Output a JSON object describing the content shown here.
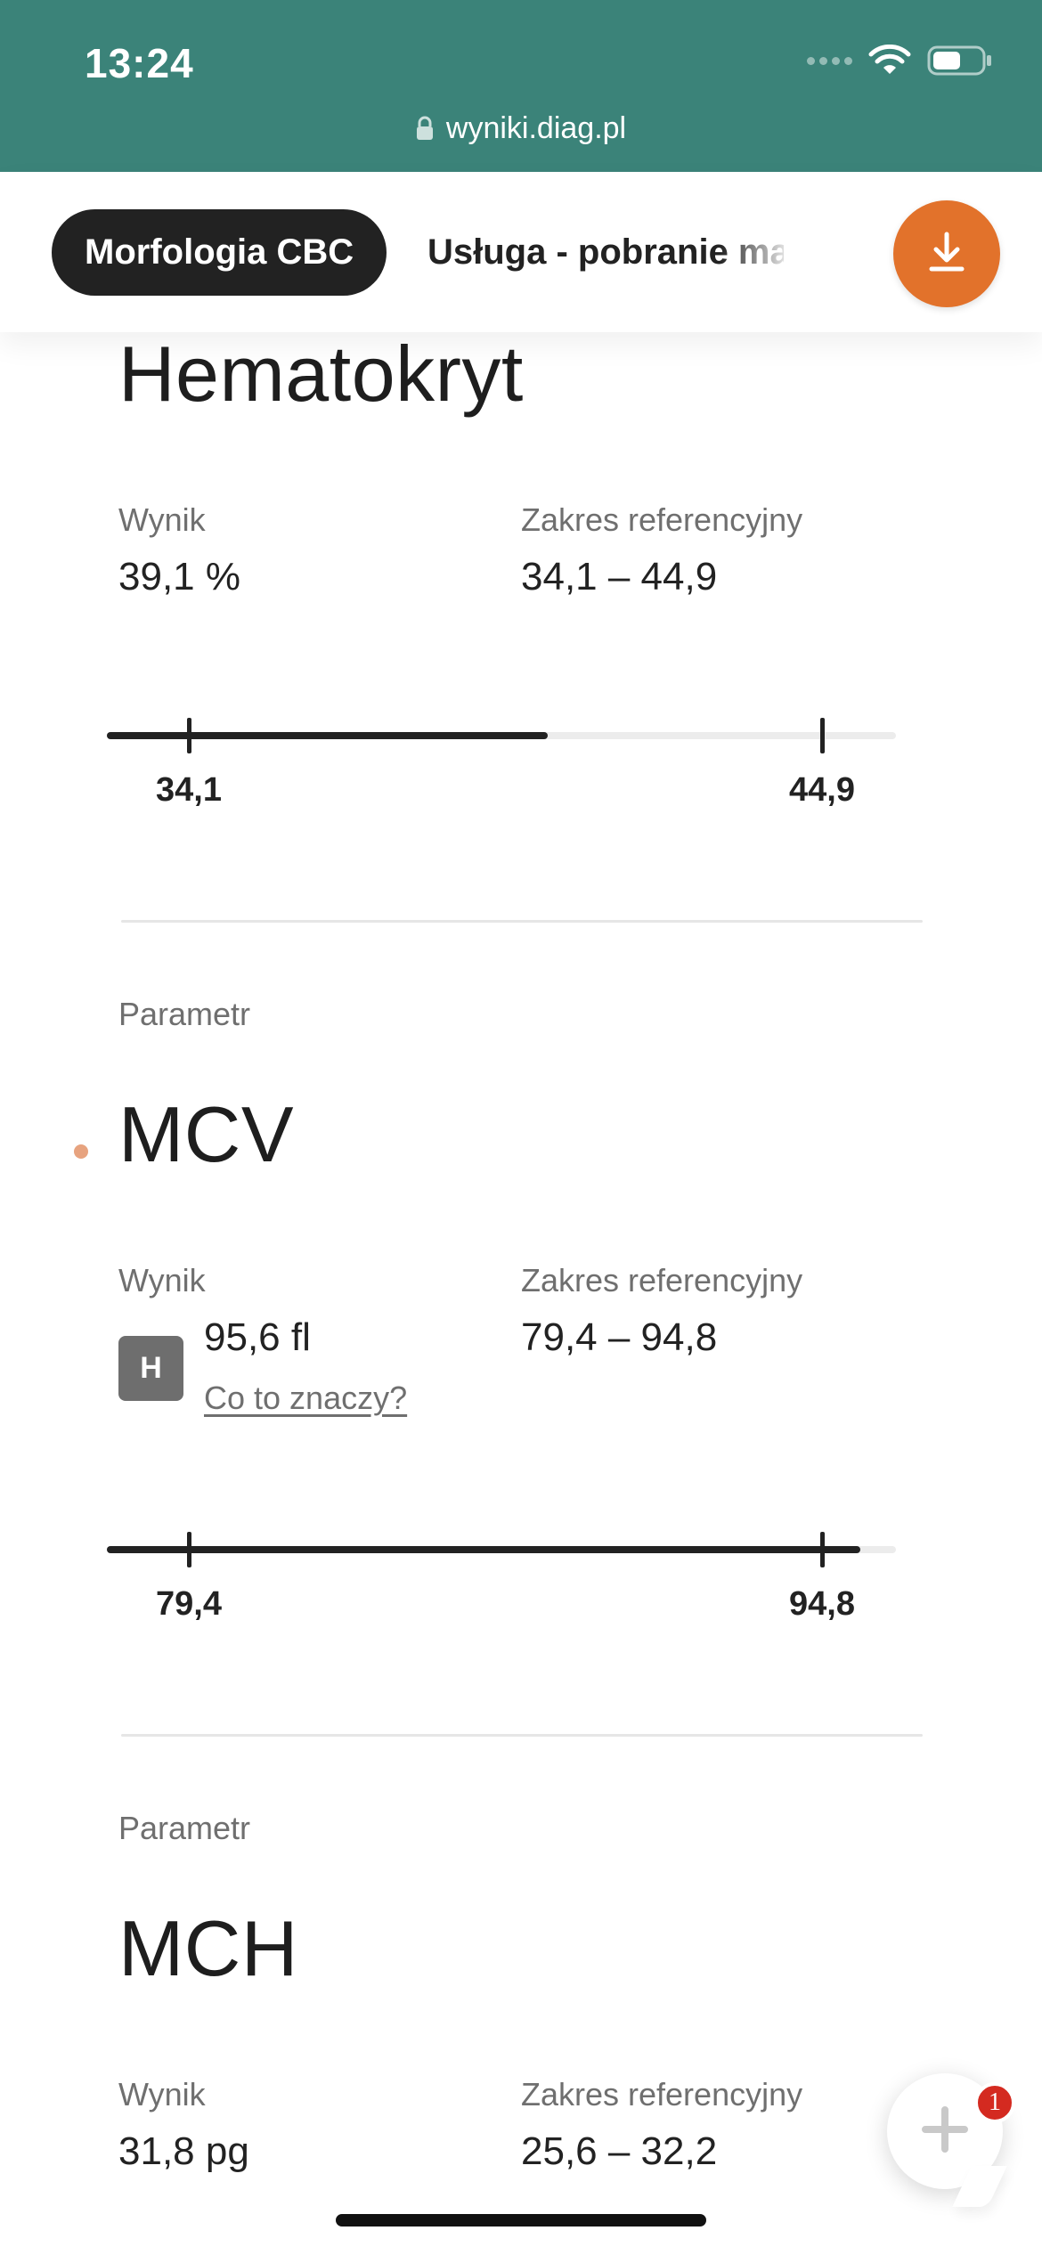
{
  "status_bar": {
    "time": "13:24",
    "url": "wyniki.diag.pl",
    "icons": [
      "signal-icon",
      "wifi-icon",
      "battery-icon",
      "lock-icon"
    ]
  },
  "tabs": [
    {
      "label": "Morfologia CBC",
      "active": true
    },
    {
      "label": "Usługa - pobranie ma",
      "active": false
    }
  ],
  "download_button": {
    "icon": "download-icon"
  },
  "params": [
    {
      "name": "Hematokryt",
      "result_label": "Wynik",
      "result_value": "39,1 %",
      "reference_label": "Zakres referencyjny",
      "reference_value": "34,1 – 44,9",
      "range_low": "34,1",
      "range_high": "44,9",
      "result_position_fraction": 0.56
    },
    {
      "section_label": "Parametr",
      "name": "MCV",
      "flagged": true,
      "result_label": "Wynik",
      "result_value": "95,6 fl",
      "flag_badge": "H",
      "explain_link": "Co to znaczy?",
      "reference_label": "Zakres referencyjny",
      "reference_value": "79,4 – 94,8",
      "range_low": "79,4",
      "range_high": "94,8",
      "result_position_fraction": 0.96
    },
    {
      "section_label": "Parametr",
      "name": "MCH",
      "result_label": "Wynik",
      "result_value": "31,8 pg",
      "reference_label": "Zakres referencyjny",
      "reference_value": "25,6 – 32,2"
    }
  ],
  "chat": {
    "icon": "plus-icon",
    "badge_count": "1"
  },
  "colors": {
    "status_bar": "#3b8379",
    "accent": "#e2722b",
    "tab_active": "#222222",
    "flag_dot": "#e7a37f",
    "badge": "#d42a20"
  }
}
